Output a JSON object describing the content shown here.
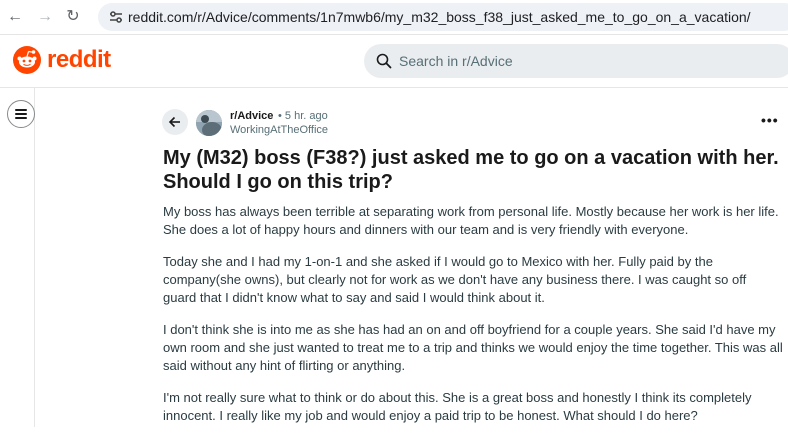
{
  "browser": {
    "url": "reddit.com/r/Advice/comments/1n7mwb6/my_m32_boss_f38_just_asked_me_to_go_on_a_vacation/"
  },
  "header": {
    "logo_text": "reddit",
    "search_placeholder": "Search in r/Advice",
    "brand_color": "#ff4500"
  },
  "post": {
    "subreddit": "r/Advice",
    "time": "• 5 hr. ago",
    "author": "WorkingAtTheOffice",
    "title": "My (M32) boss (F38?) just asked me to go on a vacation with her. Should I go on this trip?",
    "paragraphs": [
      "My boss has always been terrible at separating work from personal life. Mostly because her work is her life. She does a lot of happy hours and dinners with our team and is very friendly with everyone.",
      "Today she and I had my 1-on-1 and she asked if I would go to Mexico with her. Fully paid by the company(she owns), but clearly not for work as we don't have any business there. I was caught so off guard that I didn't know what to say and said I would think about it.",
      "I don't think she is into me as she has had an on and off boyfriend for a couple years. She said I'd have my own room and she just wanted to treat me to a trip and thinks we would enjoy the time together. This was all said without any hint of flirting or anything.",
      "I'm not really sure what to think or do about this. She is a great boss and honestly I think its completely innocent. I really like my job and would enjoy a paid trip to be honest. What should I do here?"
    ]
  }
}
